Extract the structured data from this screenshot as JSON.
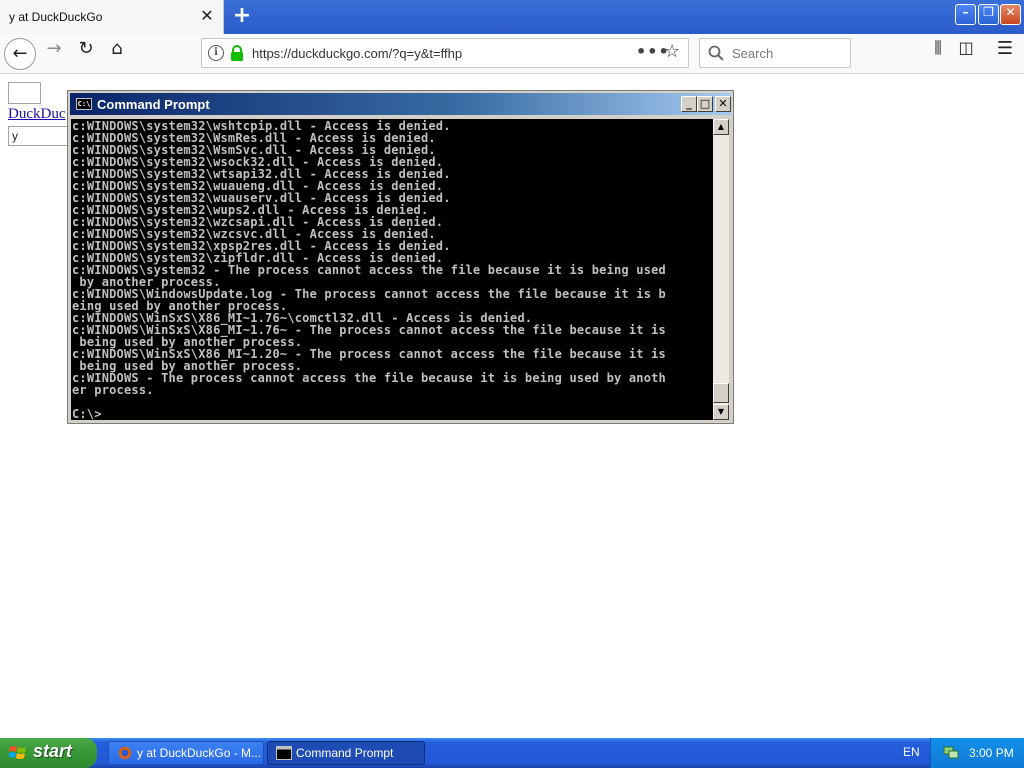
{
  "browser": {
    "tab_title": "y at DuckDuckGo",
    "tab_close_glyph": "✕",
    "new_tab_glyph": "+",
    "url": "https://duckduckgo.com/?q=y&t=ffhp",
    "url_more_glyph": "•••",
    "bookmark_glyph": "☆",
    "search_placeholder": "Search",
    "window_controls": {
      "minimize": "–",
      "restore": "❐",
      "close": "✕"
    },
    "nav_glyphs": {
      "back": "←",
      "forward": "→",
      "reload": "↻",
      "home": "⌂",
      "library": "⫼",
      "sidebar": "◫",
      "menu": "☰"
    },
    "accent": "#2a5bc9"
  },
  "page": {
    "link_text": "DuckDuc",
    "query_value": "y"
  },
  "cmd": {
    "title": "Command Prompt",
    "icon_text": "C:\\",
    "controls": {
      "minimize": "_",
      "maximize": "□",
      "close": "✕"
    },
    "lines": [
      "c:WINDOWS\\system32\\wshtcpip.dll - Access is denied.",
      "c:WINDOWS\\system32\\WsmRes.dll - Access is denied.",
      "c:WINDOWS\\system32\\WsmSvc.dll - Access is denied.",
      "c:WINDOWS\\system32\\wsock32.dll - Access is denied.",
      "c:WINDOWS\\system32\\wtsapi32.dll - Access is denied.",
      "c:WINDOWS\\system32\\wuaueng.dll - Access is denied.",
      "c:WINDOWS\\system32\\wuauserv.dll - Access is denied.",
      "c:WINDOWS\\system32\\wups2.dll - Access is denied.",
      "c:WINDOWS\\system32\\wzcsapi.dll - Access is denied.",
      "c:WINDOWS\\system32\\wzcsvc.dll - Access is denied.",
      "c:WINDOWS\\system32\\xpsp2res.dll - Access is denied.",
      "c:WINDOWS\\system32\\zipfldr.dll - Access is denied.",
      "c:WINDOWS\\system32 - The process cannot access the file because it is being used",
      " by another process.",
      "c:WINDOWS\\WindowsUpdate.log - The process cannot access the file because it is b",
      "eing used by another process.",
      "c:WINDOWS\\WinSxS\\X86_MI~1.76~\\comctl32.dll - Access is denied.",
      "c:WINDOWS\\WinSxS\\X86_MI~1.76~ - The process cannot access the file because it is",
      " being used by another process.",
      "c:WINDOWS\\WinSxS\\X86_MI~1.20~ - The process cannot access the file because it is",
      " being used by another process.",
      "c:WINDOWS - The process cannot access the file because it is being used by anoth",
      "er process.",
      "",
      "C:\\>"
    ]
  },
  "taskbar": {
    "start_label": "start",
    "tasks": [
      {
        "label": "y at DuckDuckGo - M..."
      },
      {
        "label": "Command Prompt"
      }
    ],
    "language": "EN",
    "clock": "3:00 PM"
  }
}
